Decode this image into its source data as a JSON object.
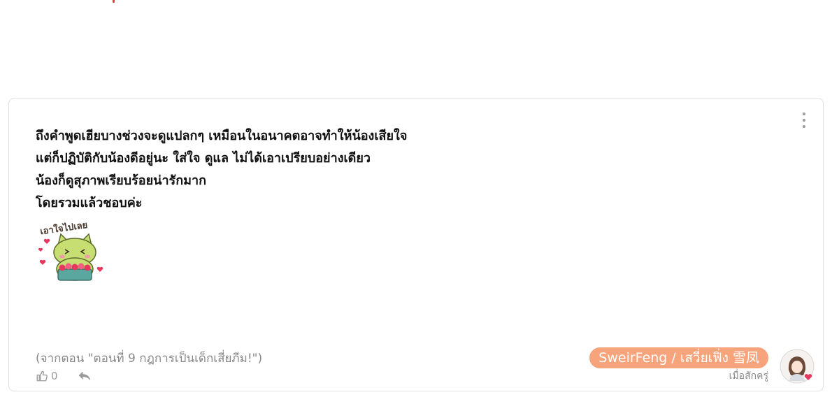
{
  "comment": {
    "lines": [
      "ถึงคำพูดเฮียบางช่วงจะดูแปลกๆ เหมือนในอนาคตอาจทำให้น้องเสียใจ",
      "แต่ก็ปฏิบัติกับน้องดีอยู่นะ ใส่ใจ ดูแล ไม่ได้เอาเปรียบอย่างเดียว",
      "น้องก็ดูสุภาพเรียบร้อยน่ารักมาก",
      "โดยรวมแล้วชอบค่ะ"
    ],
    "sticker_text": "เอาใจไปเลย",
    "source": "(จากตอน \"ตอนที่ 9 กฎการเป็นเด็กเสี่ยภีม!\")",
    "like_count": "0"
  },
  "author": {
    "name": "SweirFeng / เสวี่ยเฟิ่ง 雪凤",
    "role": "เมื่อสักครู่"
  },
  "colors": {
    "author_pill": "#f7a37b",
    "heart": "#e8375f",
    "sticker_cat": "#c7de72"
  },
  "icons": [
    "more-vertical-icon",
    "thumbs-up-icon",
    "reply-icon",
    "heart-icon"
  ]
}
